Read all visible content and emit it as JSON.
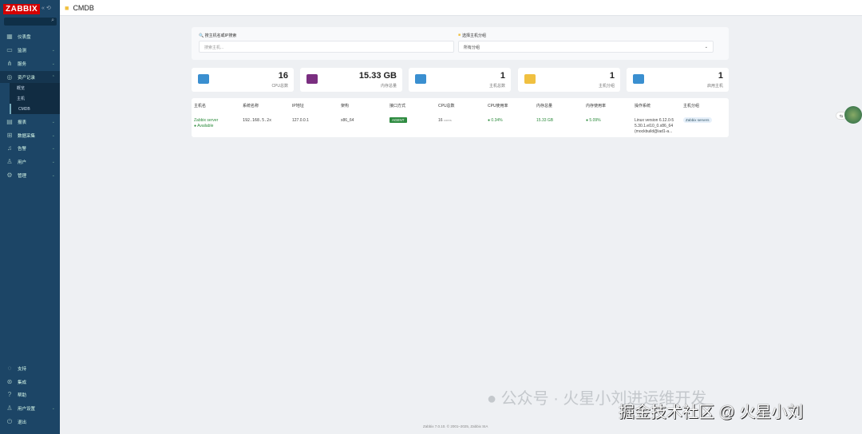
{
  "app": {
    "logo": "ZABBIX",
    "search_placeholder": ""
  },
  "sidebar": {
    "items": [
      {
        "label": "仪表盘",
        "icon": "grid-icon"
      },
      {
        "label": "监测",
        "icon": "monitor-icon"
      },
      {
        "label": "服务",
        "icon": "services-icon"
      },
      {
        "label": "资产记录",
        "icon": "inventory-icon"
      },
      {
        "label": "报表",
        "icon": "report-icon"
      },
      {
        "label": "数据采集",
        "icon": "data-collection-icon"
      },
      {
        "label": "告警",
        "icon": "bell-icon"
      },
      {
        "label": "用户",
        "icon": "user-icon"
      },
      {
        "label": "管理",
        "icon": "gear-icon"
      }
    ],
    "subitems": [
      "概览",
      "主机",
      "CMDB"
    ],
    "bottom": [
      {
        "label": "支持",
        "icon": "support-icon"
      },
      {
        "label": "集成",
        "icon": "integrations-icon"
      },
      {
        "label": "帮助",
        "icon": "help-icon"
      },
      {
        "label": "用户设置",
        "icon": "user-settings-icon"
      },
      {
        "label": "退出",
        "icon": "signout-icon"
      }
    ]
  },
  "header": {
    "title": "CMDB"
  },
  "filters": {
    "search_label": "🔍 搜主机名或IP搜索",
    "search_placeholder": "搜索主机...",
    "group_label": "选择主机分组",
    "group_value": "所有分组"
  },
  "stats": [
    {
      "value": "16",
      "label": "CPU总数",
      "color": "#3a8fd0"
    },
    {
      "value": "15.33 GB",
      "label": "内存总量",
      "color": "#7a2e80"
    },
    {
      "value": "1",
      "label": "主机总数",
      "color": "#3a8fd0"
    },
    {
      "value": "1",
      "label": "主机分组",
      "color": "#f0c040"
    },
    {
      "value": "1",
      "label": "启用主机",
      "color": "#3a8fd0"
    }
  ],
  "table": {
    "headers": [
      "主机名",
      "系统名称",
      "IP地址",
      "架构",
      "接口方式",
      "CPU总数",
      "CPU使用率",
      "内存总量",
      "内存使用率",
      "操作系统",
      "主机分组"
    ],
    "rows": [
      {
        "host": "Zabbix server",
        "status": "Available",
        "sysname": "192.168.5.2x",
        "ip": "127.0.0.1",
        "arch": "x86_64",
        "iface": "AGENT",
        "cpu": "16",
        "cpu_unit": "cores",
        "cpu_usage": "0.34%",
        "mem": "15.33 GB",
        "mem_usage": "5.09%",
        "os": [
          "Linux version 6.12.0-5",
          "5.30.1.el10_0.x86_64",
          "(mockbuild@iad1-a..."
        ],
        "group": "Zabbix servers"
      }
    ]
  },
  "footer": "Zabbix 7.0.10. © 2001–2025, Zabbix SIA",
  "watermark": {
    "line1": "公众号 · 火星小刘进运维开发",
    "line2": "掘金技术社区 @ 火星小刘"
  }
}
